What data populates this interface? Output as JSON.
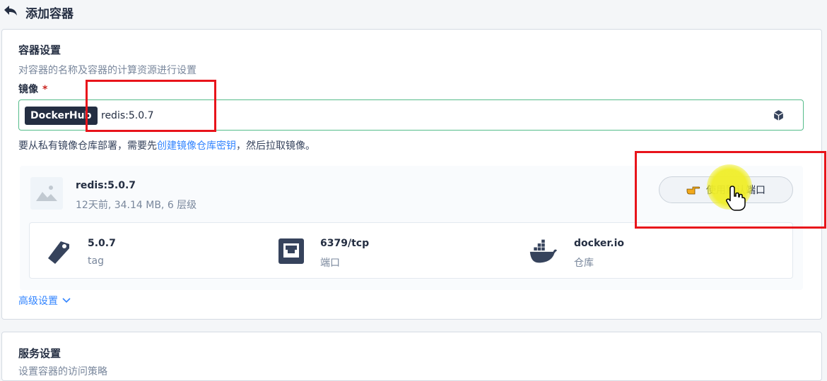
{
  "header": {
    "title": "添加容器",
    "back_icon": "back-arrow-icon"
  },
  "container_settings": {
    "title": "容器设置",
    "description": "对容器的名称及容器的计算资源进行设置",
    "image_label": "镜像",
    "required_mark": "*",
    "registry_tag": "DockerHub",
    "image_value": "redis:5.0.7",
    "helper_prefix": "要从私有镜像仓库部署，需要先",
    "helper_link": "创建镜像仓库密钥",
    "helper_suffix": "，然后拉取镜像。"
  },
  "image_result": {
    "name": "redis:5.0.7",
    "meta": "12天前, 34.14 MB, 6 层级",
    "use_default_ports_button": "使用默认端口",
    "info": [
      {
        "icon": "tag-icon",
        "value": "5.0.7",
        "key": "tag"
      },
      {
        "icon": "network-port-icon",
        "value": "6379/tcp",
        "key": "端口"
      },
      {
        "icon": "docker-whale-icon",
        "value": "docker.io",
        "key": "仓库"
      }
    ]
  },
  "advanced_settings": {
    "label": "高级设置"
  },
  "service_settings": {
    "title": "服务设置",
    "description": "设置容器的访问策略"
  },
  "colors": {
    "accent_green": "#55bc8a",
    "link_blue": "#3385ff",
    "annotation_red": "#e8141b",
    "highlight_yellow": "#f0ee28",
    "dark_tag": "#242e42"
  }
}
